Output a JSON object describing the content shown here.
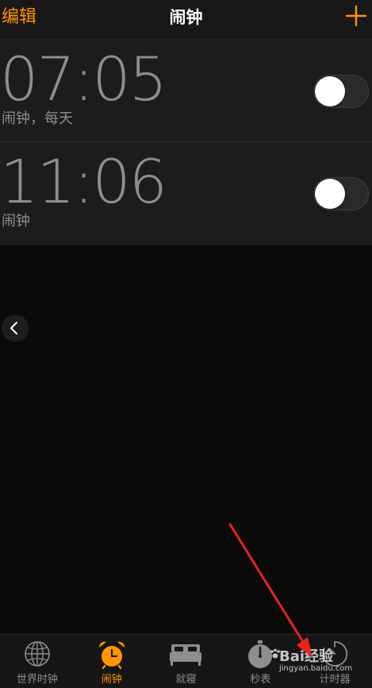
{
  "navbar": {
    "edit_label": "编辑",
    "title": "闹钟",
    "add_icon": "plus-icon",
    "accent_color": "#ff9500"
  },
  "alarms": [
    {
      "time": "07:05",
      "label": "闹钟，每天",
      "enabled": false
    },
    {
      "time": "11:06",
      "label": "闹钟",
      "enabled": false
    }
  ],
  "back_icon": "chevron-left-icon",
  "tabbar": {
    "tabs": [
      {
        "label": "世界时钟",
        "icon": "globe-icon",
        "active": false
      },
      {
        "label": "闹钟",
        "icon": "alarm-clock-icon",
        "active": true
      },
      {
        "label": "就寝",
        "icon": "bed-icon",
        "active": false
      },
      {
        "label": "秒表",
        "icon": "stopwatch-icon",
        "active": false
      },
      {
        "label": "计时器",
        "icon": "timer-icon",
        "active": false
      }
    ]
  },
  "watermark": {
    "brand": "Bai经验",
    "url": "jingyan.baidu.com"
  },
  "annotation": {
    "arrow_color": "#e8231f"
  }
}
